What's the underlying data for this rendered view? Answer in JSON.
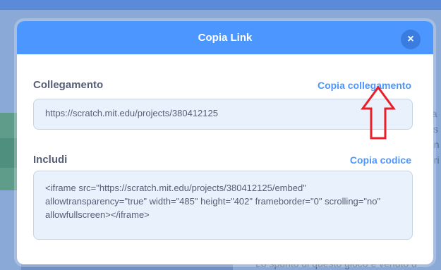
{
  "modal": {
    "title": "Copia Link",
    "close_label": "×",
    "link_section": {
      "label": "Collegamento",
      "action": "Copia collegamento",
      "value": "https://scratch.mit.edu/projects/380412125"
    },
    "embed_section": {
      "label": "Includi",
      "action": "Copia codice",
      "value": "<iframe src=\"https://scratch.mit.edu/projects/380412125/embed\" allowtransparency=\"true\" width=\"485\" height=\"402\" frameborder=\"0\" scrolling=\"no\" allowfullscreen></iframe>"
    }
  },
  "background": {
    "bottom_text": "Lo spunto di questo gioco è venuto d",
    "side_text": "ra ss on ori"
  },
  "colors": {
    "accent": "#4c97ff",
    "annotation": "#e8202a"
  },
  "icons": {
    "close": "close-icon",
    "annotation_arrow": "arrow-up-icon"
  }
}
